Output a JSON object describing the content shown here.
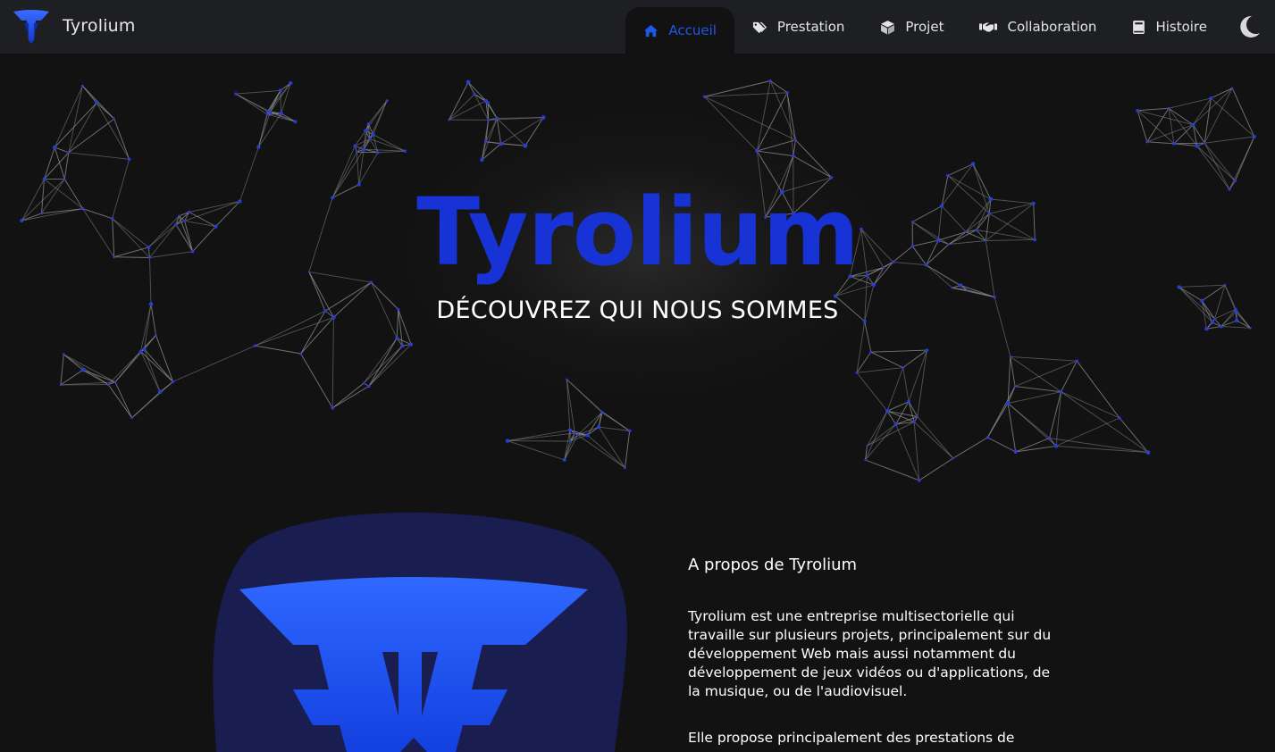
{
  "brand": {
    "name": "Tyrolium"
  },
  "nav": {
    "items": [
      {
        "label": "Accueil",
        "icon": "home-icon",
        "active": true
      },
      {
        "label": "Prestation",
        "icon": "tags-icon",
        "active": false
      },
      {
        "label": "Projet",
        "icon": "cube-icon",
        "active": false
      },
      {
        "label": "Collaboration",
        "icon": "handshake-icon",
        "active": false
      },
      {
        "label": "Histoire",
        "icon": "book-icon",
        "active": false
      }
    ],
    "theme_toggle_icon": "moon-icon"
  },
  "hero": {
    "title": "Tyrolium",
    "subtitle": "DÉCOUVREZ QUI NOUS SOMMES"
  },
  "about": {
    "title": "A propos de Tyrolium",
    "paragraph1": "Tyrolium est une entreprise multisectorielle qui travaille sur plusieurs projets, principalement sur du développement Web mais aussi notamment du développement de jeux vidéos ou d'applications, de la musique, ou de l'audiovisuel.",
    "paragraph2": "Elle propose principalement des prestations de"
  },
  "colors": {
    "accent": "#1733d6",
    "nav_active": "#1f57e6",
    "background": "#121212",
    "navbar": "#1e1f22",
    "logo_blue": "#1a4ff5",
    "blob": "#1a1d4f"
  }
}
